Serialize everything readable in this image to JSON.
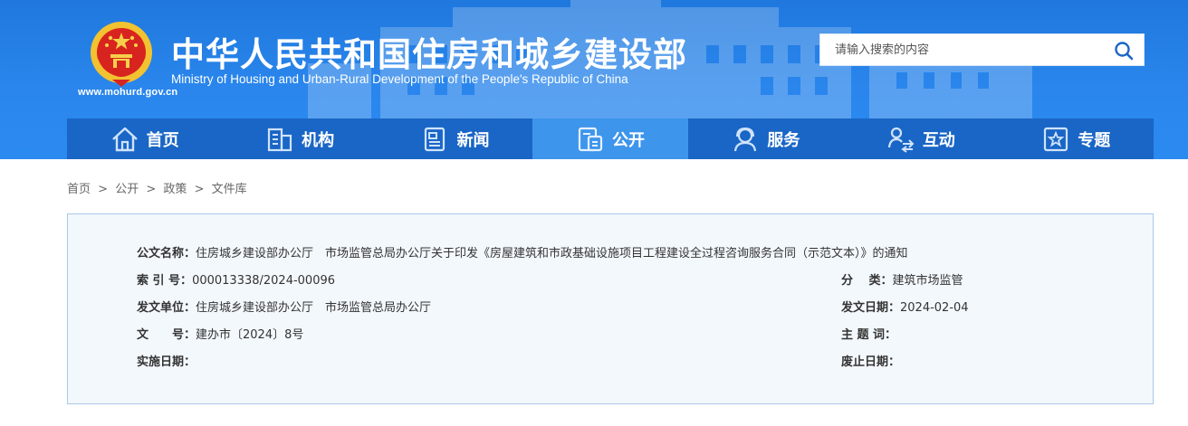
{
  "site": {
    "title_cn": "中华人民共和国住房和城乡建设部",
    "title_en": "Ministry of Housing and Urban-Rural Development of the People's Republic of China",
    "domain": "www.mohurd.gov.cn",
    "search_placeholder": "请输入搜索的内容"
  },
  "nav": {
    "items": [
      {
        "label": "首页",
        "icon": "home-icon"
      },
      {
        "label": "机构",
        "icon": "building-icon"
      },
      {
        "label": "新闻",
        "icon": "news-icon"
      },
      {
        "label": "公开",
        "icon": "document-icon"
      },
      {
        "label": "服务",
        "icon": "service-icon"
      },
      {
        "label": "互动",
        "icon": "interact-icon"
      },
      {
        "label": "专题",
        "icon": "topic-icon"
      }
    ],
    "active_index": 3
  },
  "breadcrumb": [
    "首页",
    "公开",
    "政策",
    "文件库"
  ],
  "breadcrumb_sep": ">",
  "document": {
    "name_label": "公文名称：",
    "name_value": "住房城乡建设部办公厅　市场监管总局办公厅关于印发《房屋建筑和市政基础设施项目工程建设全过程咨询服务合同（示范文本）》的通知",
    "index_label": "索 引 号：",
    "index_value": "000013338/2024-00096",
    "category_label": "分　 类：",
    "category_value": "建筑市场监管",
    "issuer_label": "发文单位：",
    "issuer_value": "住房城乡建设部办公厅　市场监管总局办公厅",
    "date_label": "发文日期：",
    "date_value": "2024-02-04",
    "docno_label": "文　　号：",
    "docno_value": "建办市〔2024〕8号",
    "keywords_label": "主 题 词：",
    "keywords_value": "",
    "effective_label": "实施日期：",
    "effective_value": "",
    "expire_label": "废止日期：",
    "expire_value": ""
  },
  "colors": {
    "header_blue": "#2a86ec",
    "nav_blue": "#1a66c6",
    "nav_active": "#3d95ec",
    "infobox_bg": "#f3f8fd",
    "infobox_border": "#a9c8e8"
  }
}
